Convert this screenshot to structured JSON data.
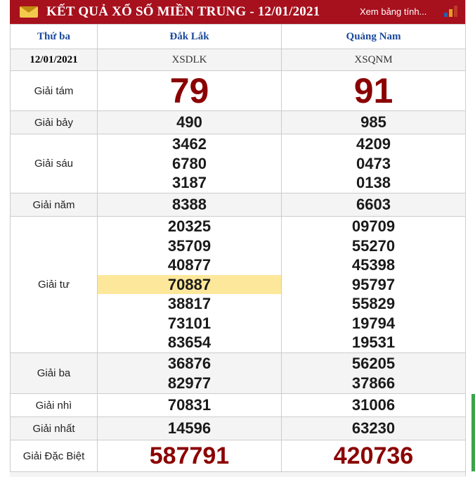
{
  "header": {
    "title": "KẾT QUẢ XỔ SỐ MIỀN TRUNG - 12/01/2021",
    "more_link": "Xem bảng tính...",
    "colors": {
      "background": "#a7101d",
      "text": "#ffffff",
      "bars": [
        "#2a5db0",
        "#e0a020",
        "#c0392b"
      ]
    },
    "icons": [
      "mail-icon",
      "bar-chart-icon"
    ]
  },
  "table": {
    "day_label": "Thứ ba",
    "date": "12/01/2021",
    "provinces": [
      {
        "name": "Đắk Lắk",
        "code": "XSDLK"
      },
      {
        "name": "Quảng Nam",
        "code": "XSQNM"
      }
    ],
    "prizes": {
      "g8": {
        "label": "Giải tám",
        "values": [
          [
            "79"
          ],
          [
            "91"
          ]
        ]
      },
      "g7": {
        "label": "Giải bảy",
        "values": [
          [
            "490"
          ],
          [
            "985"
          ]
        ]
      },
      "g6": {
        "label": "Giải sáu",
        "values": [
          [
            "3462",
            "6780",
            "3187"
          ],
          [
            "4209",
            "0473",
            "0138"
          ]
        ]
      },
      "g5": {
        "label": "Giải năm",
        "values": [
          [
            "8388"
          ],
          [
            "6603"
          ]
        ]
      },
      "g4": {
        "label": "Giải tư",
        "values": [
          [
            "20325",
            "35709",
            "40877",
            "70887",
            "38817",
            "73101",
            "83654"
          ],
          [
            "09709",
            "55270",
            "45398",
            "95797",
            "55829",
            "19794",
            "19531"
          ]
        ]
      },
      "g3": {
        "label": "Giải ba",
        "values": [
          [
            "36876",
            "82977"
          ],
          [
            "56205",
            "37866"
          ]
        ]
      },
      "g2": {
        "label": "Giải nhì",
        "values": [
          [
            "70831"
          ],
          [
            "31006"
          ]
        ]
      },
      "g1": {
        "label": "Giải nhất",
        "values": [
          [
            "14596"
          ],
          [
            "63230"
          ]
        ]
      },
      "db": {
        "label": "Giải Đặc Biệt",
        "values": [
          [
            "587791"
          ],
          [
            "420736"
          ]
        ]
      }
    },
    "highlighted": {
      "prize": "g4",
      "province": 0,
      "index": 3,
      "color": "#fde79a"
    },
    "colors": {
      "header_text": "#1b4a9a",
      "special_number": "#8b0000",
      "border": "#cccccc"
    }
  }
}
